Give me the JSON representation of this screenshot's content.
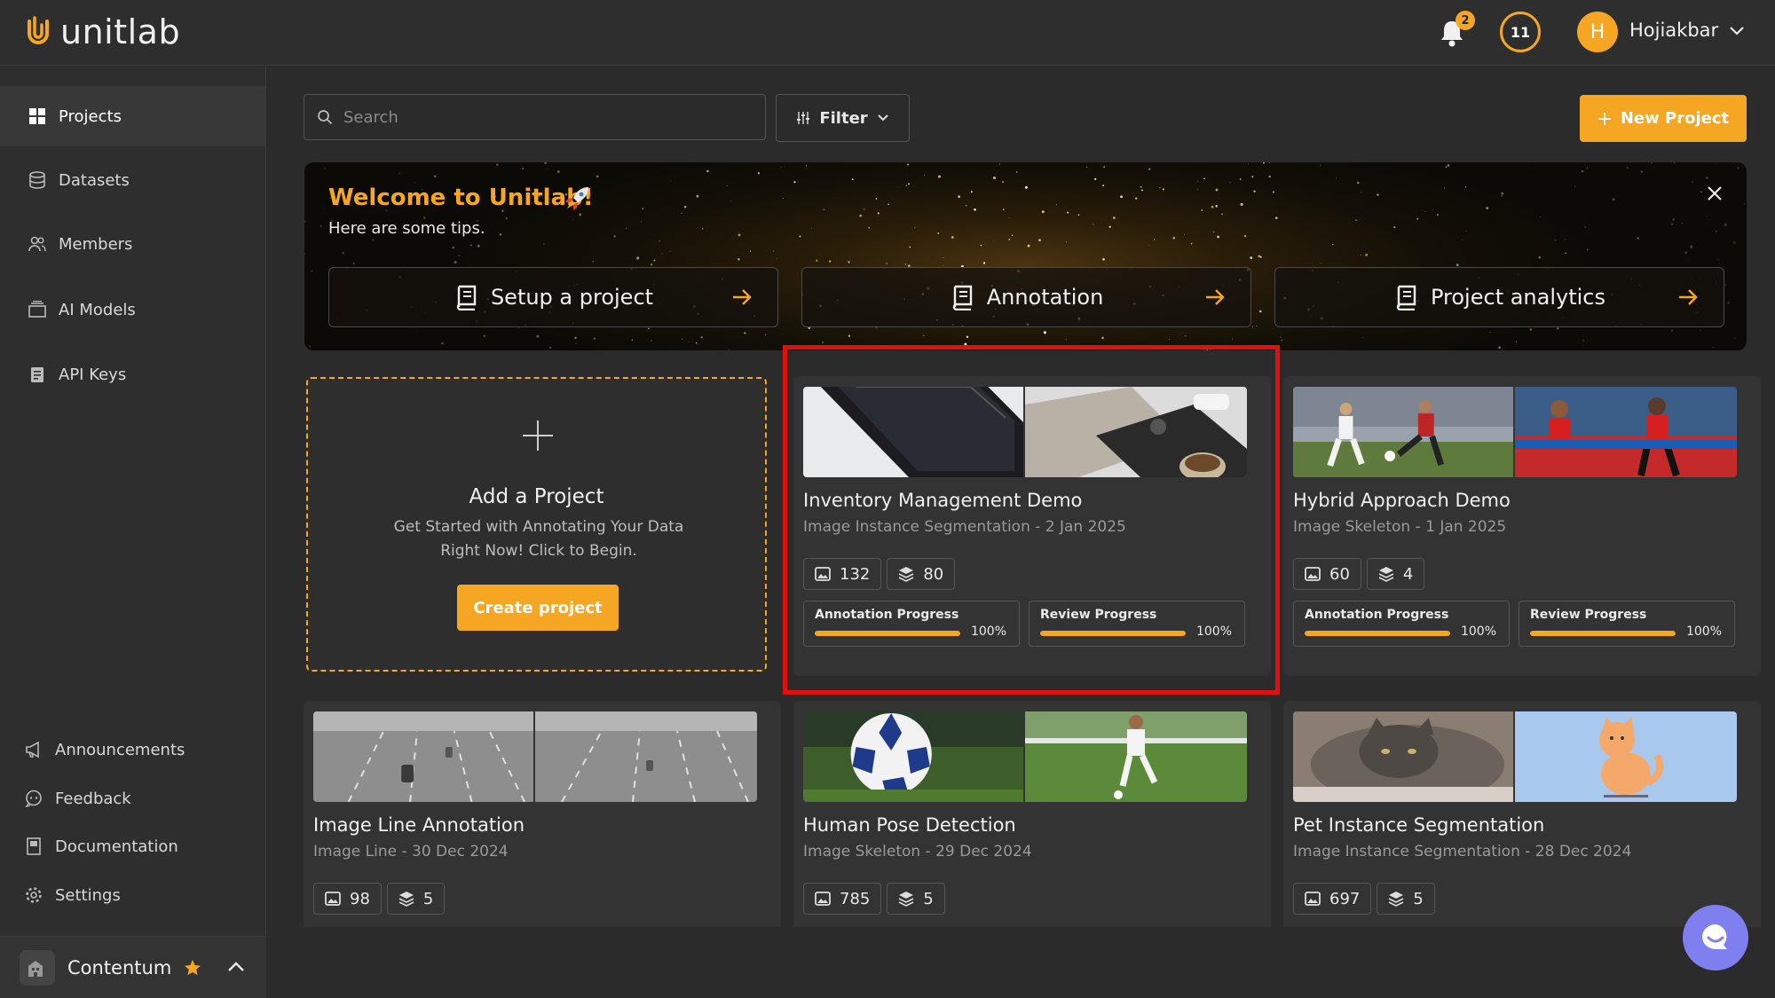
{
  "app": {
    "logo_text": "unitlab",
    "notification_count": "2",
    "credits": "11",
    "user_initial": "H",
    "user_name": "Hojiakbar"
  },
  "sidebar": {
    "items": [
      {
        "label": "Projects",
        "icon": "grid-icon",
        "active": true
      },
      {
        "label": "Datasets",
        "icon": "database-icon"
      },
      {
        "label": "Members",
        "icon": "users-icon"
      },
      {
        "label": "AI Models",
        "icon": "box-icon"
      },
      {
        "label": "API Keys",
        "icon": "key-icon"
      }
    ],
    "bottom_items": [
      {
        "label": "Announcements",
        "icon": "megaphone-icon"
      },
      {
        "label": "Feedback",
        "icon": "chat-icon"
      },
      {
        "label": "Documentation",
        "icon": "book-icon"
      },
      {
        "label": "Settings",
        "icon": "gear-icon"
      }
    ],
    "organization": "Contentum"
  },
  "toolbar": {
    "search_placeholder": "Search",
    "filter_label": "Filter",
    "new_project_label": "New Project"
  },
  "welcome": {
    "title": "Welcome to Unitlab!",
    "subtitle": "Here are some tips.",
    "tips": [
      "Setup a project",
      "Annotation",
      "Project analytics"
    ]
  },
  "add_project": {
    "title": "Add a Project",
    "description": "Get Started with Annotating Your Data Right Now! Click to Begin.",
    "button": "Create project"
  },
  "progress_labels": {
    "annotation": "Annotation Progress",
    "review": "Review Progress"
  },
  "projects": [
    {
      "title": "Inventory Management Demo",
      "subtitle": "Image Instance Segmentation - 2 Jan 2025",
      "images": "132",
      "layers": "80",
      "annotation_pct": "100%",
      "review_pct": "100%",
      "annotation_value": 100,
      "review_value": 100
    },
    {
      "title": "Hybrid Approach Demo",
      "subtitle": "Image Skeleton - 1 Jan 2025",
      "images": "60",
      "layers": "4",
      "annotation_pct": "100%",
      "review_pct": "100%",
      "annotation_value": 100,
      "review_value": 100
    },
    {
      "title": "Image Line Annotation",
      "subtitle": "Image Line - 30 Dec 2024",
      "images": "98",
      "layers": "5"
    },
    {
      "title": "Human Pose Detection",
      "subtitle": "Image Skeleton - 29 Dec 2024",
      "images": "785",
      "layers": "5"
    },
    {
      "title": "Pet Instance Segmentation",
      "subtitle": "Image Instance Segmentation - 28 Dec 2024",
      "images": "697",
      "layers": "5"
    }
  ],
  "colors": {
    "accent": "#f5a623",
    "highlight": "#e01010",
    "background": "#2b2b2b"
  }
}
